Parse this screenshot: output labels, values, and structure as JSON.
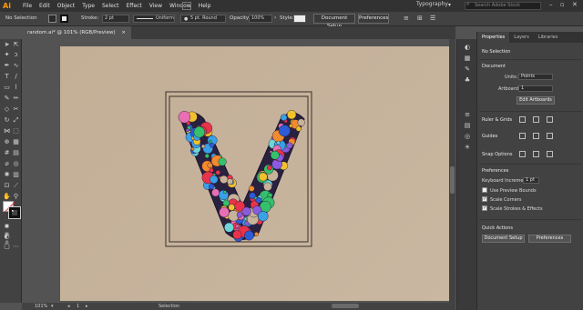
{
  "menubar": {
    "logo": "Ai",
    "items": [
      "File",
      "Edit",
      "Object",
      "Type",
      "Select",
      "Effect",
      "View",
      "Window",
      "Help"
    ],
    "workspace": "Typography",
    "search_placeholder": "Search Adobe Stock"
  },
  "control_bar": {
    "selection_label": "No Selection",
    "stroke_label": "Stroke:",
    "stroke_value": "2 pt",
    "profile_value": "Uniform",
    "brush_value": "5 pt. Round",
    "opacity_label": "Opacity:",
    "opacity_value": "100%",
    "style_label": "Style:",
    "doc_setup_label": "Document Setup",
    "preferences_label": "Preferences"
  },
  "document_tab": {
    "title": "random.ai* @ 101% (RGB/Preview)",
    "close": "×"
  },
  "status_bar": {
    "zoom": "101%",
    "page": "1",
    "tool": "Selection"
  },
  "panel": {
    "tabs": [
      "Properties",
      "Layers",
      "Libraries"
    ],
    "selection_label": "No Selection",
    "document": {
      "heading": "Document",
      "units_label": "Units:",
      "units_value": "Points",
      "artboard_label": "Artboard:",
      "artboard_value": "1",
      "edit_artboards_label": "Edit Artboards"
    },
    "rulers": {
      "heading": "Ruler & Grids"
    },
    "guides": {
      "heading": "Guides"
    },
    "snap": {
      "heading": "Snap Options"
    },
    "preferences": {
      "heading": "Preferences",
      "keyboard_label": "Keyboard Increment:",
      "keyboard_value": "1 pt",
      "use_preview_bounds": "Use Preview Bounds",
      "scale_corners": "Scale Corners",
      "scale_strokes": "Scale Strokes & Effects",
      "use_preview_bounds_checked": false,
      "scale_corners_checked": true,
      "scale_strokes_checked": true
    },
    "quick_actions": {
      "heading": "Quick Actions",
      "document_setup_label": "Document Setup",
      "preferences_label": "Preferences"
    }
  },
  "colors": {
    "accent": "#ff9a00",
    "letter_fill": "#2a2140"
  }
}
